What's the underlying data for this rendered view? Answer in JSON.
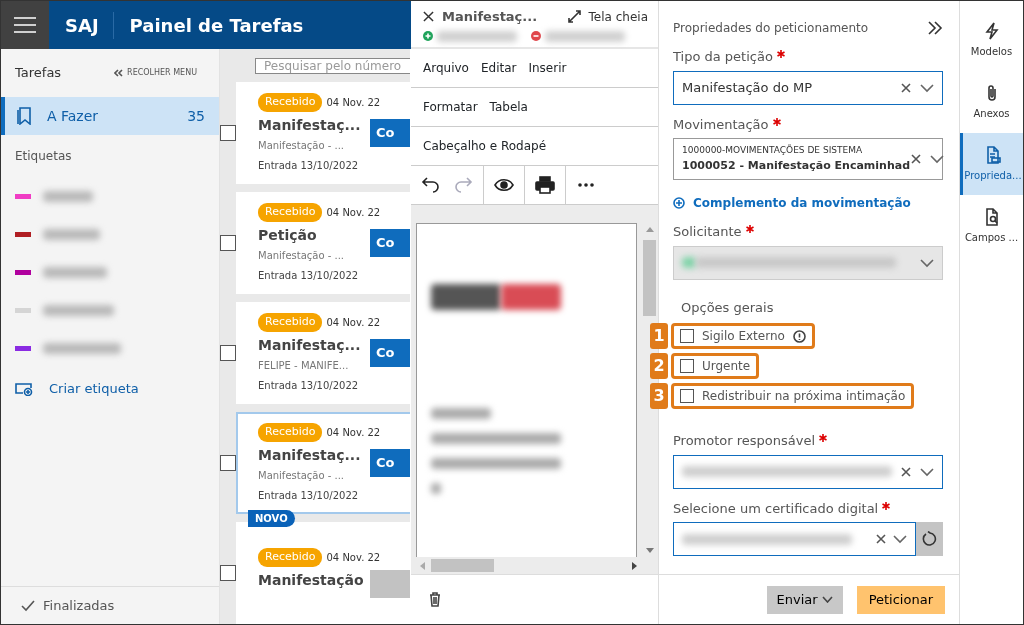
{
  "header": {
    "app": "SAJ",
    "title": "Painel de Tarefas"
  },
  "sidebar": {
    "heading": "Tarefas",
    "collapse": "RECOLHER MENU",
    "items": [
      {
        "label": "A Fazer",
        "count": "35",
        "selected": true
      }
    ],
    "labels_heading": "Etiquetas",
    "labels": [
      {
        "color": "#f03cc4"
      },
      {
        "color": "#b01e23"
      },
      {
        "color": "#b0009e"
      },
      {
        "color": "#d5d5d5"
      },
      {
        "color": "#8a2be2"
      }
    ],
    "create_label": "Criar etiqueta",
    "footer": "Finalizadas"
  },
  "search": {
    "placeholder": "Pesquisar pelo número"
  },
  "tasks": [
    {
      "status": "Recebido",
      "date": "04 Nov. 22",
      "title": "Manifestaç...",
      "subtitle": "Manifestação - ...",
      "entry": "Entrada 13/10/2022",
      "checked": false,
      "selected": false,
      "new": false,
      "action": {
        "label": "Co",
        "disabled": false
      }
    },
    {
      "status": "Recebido",
      "date": "04 Nov. 22",
      "title": "Petição",
      "subtitle": "Manifestação - ...",
      "entry": "Entrada 13/10/2022",
      "checked": false,
      "selected": false,
      "new": false,
      "action": {
        "label": "Co",
        "disabled": false
      }
    },
    {
      "status": "Recebido",
      "date": "04 Nov. 22",
      "title": "Manifestaç...",
      "subtitle": "FELIPE - MANIFE...",
      "entry": "Entrada 13/10/2022",
      "checked": false,
      "selected": false,
      "new": false,
      "action": {
        "label": "Co",
        "disabled": false
      }
    },
    {
      "status": "Recebido",
      "date": "04 Nov. 22",
      "title": "Manifestaç...",
      "subtitle": "Manifestação - ...",
      "entry": "Entrada 13/10/2022",
      "checked": false,
      "selected": true,
      "new": false,
      "action": {
        "label": "Co",
        "disabled": false
      }
    },
    {
      "status": "Recebido",
      "date": "04 Nov. 22",
      "title": "Manifestação",
      "checked": false,
      "selected": false,
      "new": true,
      "new_label": "NOVO",
      "action": {
        "disabled": true
      }
    }
  ],
  "editor": {
    "title": "Manifestaç...",
    "fullscreen": "Tela cheia",
    "menu_rows": [
      {
        "items": [
          "Arquivo",
          "Editar",
          "Inserir"
        ]
      },
      {
        "items": [
          "Formatar",
          "Tabela"
        ]
      },
      {
        "items": [
          "Cabeçalho e Rodapé"
        ]
      }
    ],
    "toolbar": [
      {
        "kind": "undo",
        "disabled": false
      },
      {
        "kind": "redo",
        "disabled": true
      },
      {
        "kind": "preview",
        "disabled": false
      },
      {
        "kind": "print",
        "disabled": false
      },
      {
        "kind": "more",
        "disabled": false
      }
    ]
  },
  "properties": {
    "title": "Propriedades do peticionamento",
    "petition_type": {
      "label": "Tipo da petição",
      "required": true,
      "value": "Manifestação do MP"
    },
    "movement": {
      "label": "Movimentação",
      "required": true,
      "group": "1000000-MOVIMENTAÇÕES DE SISTEMA",
      "value": "1000052 - Manifestação Encaminhad"
    },
    "complement_link": "Complemento da movimentação",
    "requester": {
      "label": "Solicitante",
      "required": true,
      "disabled": true
    },
    "options": {
      "heading": "Opções gerais",
      "items": [
        {
          "label": "Sigilo Externo",
          "checked": false,
          "info": true,
          "callout": "1"
        },
        {
          "label": "Urgente",
          "checked": false,
          "info": false,
          "callout": "2"
        },
        {
          "label": "Redistribuir na próxima intimação",
          "checked": false,
          "info": false,
          "callout": "3"
        }
      ]
    },
    "promoter": {
      "label": "Promotor responsável",
      "required": true
    },
    "certificate": {
      "label": "Selecione um certificado digital",
      "required": true
    },
    "buttons": [
      {
        "label": "Enviar",
        "kind": "dropdown"
      },
      {
        "label": "Peticionar",
        "kind": "primary"
      }
    ]
  },
  "rail": [
    {
      "label": "Modelos",
      "kind": "bolt",
      "selected": false
    },
    {
      "label": "Anexos",
      "kind": "clip",
      "selected": false
    },
    {
      "label": "Proprieda...",
      "kind": "props",
      "selected": true
    },
    {
      "label": "Campos ...",
      "kind": "search-doc",
      "selected": false
    }
  ]
}
